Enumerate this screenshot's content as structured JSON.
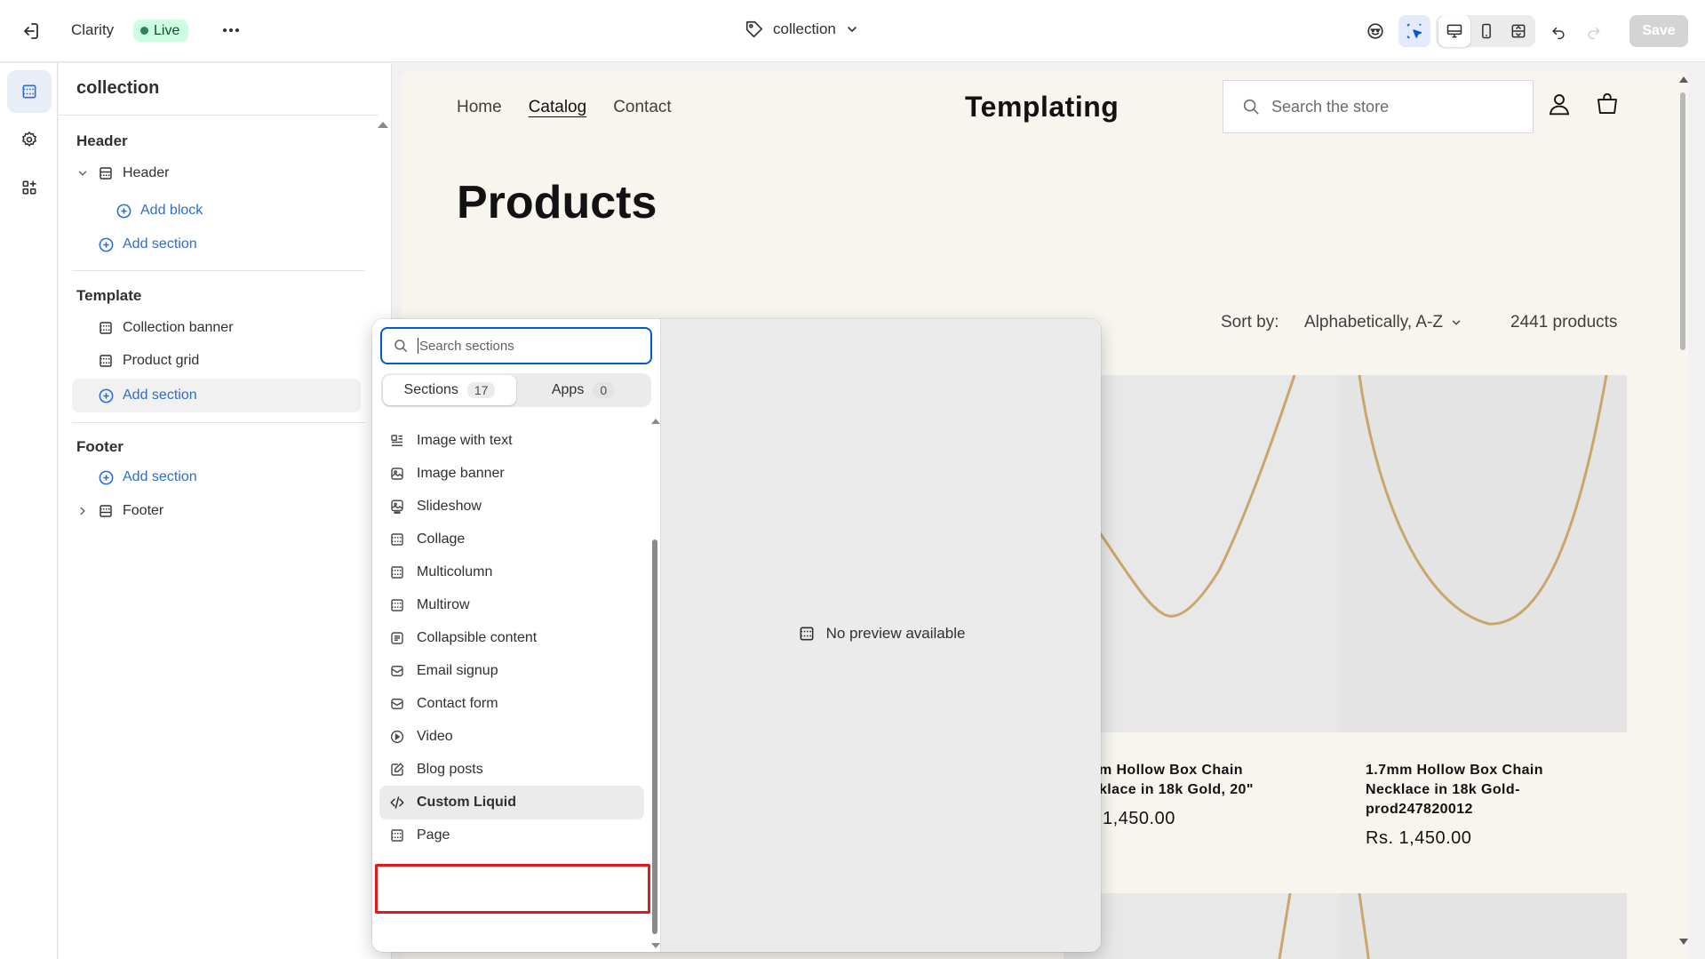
{
  "topbar": {
    "theme_name": "Clarity",
    "live_badge": "Live",
    "more_icon": "more-horizontal-icon",
    "page_selector": "collection",
    "save_label": "Save"
  },
  "rail": {
    "items": [
      {
        "name": "sections",
        "icon": "sections-icon",
        "active": true
      },
      {
        "name": "theme-settings",
        "icon": "gear-icon",
        "active": false
      },
      {
        "name": "app-embeds",
        "icon": "apps-icon",
        "active": false
      }
    ]
  },
  "sidebar": {
    "title": "collection",
    "header_group": "Header",
    "header_item": "Header",
    "add_block": "Add block",
    "add_section_header": "Add section",
    "template_group": "Template",
    "template_items": [
      "Collection banner",
      "Product grid"
    ],
    "add_section_template": "Add section",
    "footer_group": "Footer",
    "add_section_footer": "Add section",
    "footer_item": "Footer"
  },
  "preview": {
    "nav": [
      "Home",
      "Catalog",
      "Contact"
    ],
    "logo": "Templating",
    "search_placeholder": "Search the store",
    "page_title": "Products",
    "sort_label": "Sort by:",
    "sort_value": "Alphabetically, A-Z",
    "product_count": "2441 products",
    "products": [
      {
        "name": "m Hollow Box Chain\nklace in 18k Gold, 20\"",
        "price": "1,450.00"
      },
      {
        "name": "1.7mm Hollow Box Chain\nNecklace in 18k Gold-\nprod247820012",
        "price": "Rs. 1,450.00"
      }
    ]
  },
  "popover": {
    "search_placeholder": "Search sections",
    "tabs": [
      {
        "label": "Sections",
        "count": "17",
        "active": true
      },
      {
        "label": "Apps",
        "count": "0",
        "active": false
      }
    ],
    "items": [
      {
        "label": "Image with text",
        "icon": "image-with-text-icon"
      },
      {
        "label": "Image banner",
        "icon": "image-icon"
      },
      {
        "label": "Slideshow",
        "icon": "slideshow-icon"
      },
      {
        "label": "Collage",
        "icon": "layout-icon"
      },
      {
        "label": "Multicolumn",
        "icon": "layout-icon"
      },
      {
        "label": "Multirow",
        "icon": "layout-icon"
      },
      {
        "label": "Collapsible content",
        "icon": "list-icon"
      },
      {
        "label": "Email signup",
        "icon": "email-icon"
      },
      {
        "label": "Contact form",
        "icon": "email-icon"
      },
      {
        "label": "Video",
        "icon": "play-icon"
      },
      {
        "label": "Blog posts",
        "icon": "edit-icon"
      },
      {
        "label": "Custom Liquid",
        "icon": "code-icon",
        "highlighted": true
      },
      {
        "label": "Page",
        "icon": "layout-icon"
      }
    ],
    "no_preview": "No preview available",
    "highlight_color": "#e01b1b"
  },
  "colors": {
    "accent": "#2c6ecb",
    "live_bg": "#cdfee1",
    "live_text": "#0c5132",
    "preview_bg": "#f8f5ef"
  }
}
